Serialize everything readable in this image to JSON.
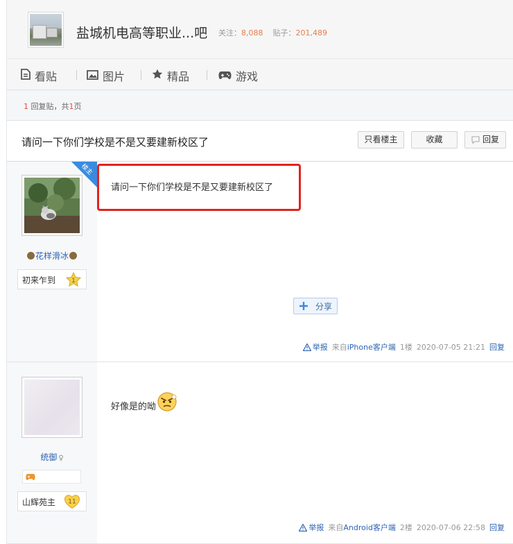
{
  "forum": {
    "name": "盐城机电高等职业...吧",
    "follow_label": "关注：",
    "follow_count": "8,088",
    "posts_label": "贴子：",
    "posts_count": "201,489"
  },
  "nav": {
    "tabs": [
      {
        "label": "看贴",
        "icon": "document-icon"
      },
      {
        "label": "图片",
        "icon": "image-icon"
      },
      {
        "label": "精品",
        "icon": "star-icon"
      },
      {
        "label": "游戏",
        "icon": "gamepad-icon"
      }
    ]
  },
  "pager": {
    "reply_count": "1",
    "reply_text": "回复贴，共",
    "page_count": "1",
    "page_text": "页"
  },
  "thread": {
    "title": "请问一下你们学校是不是又要建新校区了",
    "buttons": {
      "only_op": "只看楼主",
      "favorite": "收藏",
      "reply": "回复"
    }
  },
  "posts": [
    {
      "corner_badge": "楼主",
      "username": "花样滑冰",
      "level_title": "初来乍到",
      "level_num": "1",
      "content": "请问一下你们学校是不是又要建新校区了",
      "share_label": "分享",
      "report": "举报",
      "from_prefix": "来自",
      "client": "iPhone客户端",
      "floor": "1楼",
      "time": "2020-07-05 21:21",
      "reply": "回复",
      "colors": {
        "highlight": "#e3231b"
      }
    },
    {
      "username": "统御",
      "level_title": "山辉苑主",
      "level_num": "11",
      "content": "好像是的呦",
      "report": "举报",
      "from_prefix": "来自",
      "client": "Android客户端",
      "floor": "2楼",
      "time": "2020-07-06 22:58",
      "reply": "回复"
    }
  ]
}
